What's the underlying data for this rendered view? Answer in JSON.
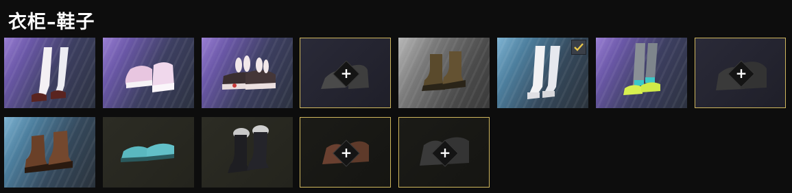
{
  "title": "衣柜–鞋子",
  "plus_symbol": "+",
  "items": [
    {
      "name": "white-stockings-maryjanes",
      "icon": "stockings-maryjane-icon",
      "background": "purple",
      "equipped": false,
      "empty": false
    },
    {
      "name": "pink-sneakers",
      "icon": "pink-sneakers-icon",
      "background": "purple",
      "equipped": false,
      "empty": false
    },
    {
      "name": "bunny-sneakers",
      "icon": "bunny-sneakers-icon",
      "background": "purple",
      "equipped": false,
      "empty": false
    },
    {
      "name": "empty-slot-black-shoes",
      "icon": "black-shoes-silhouette-icon",
      "background": "empty",
      "equipped": false,
      "empty": true
    },
    {
      "name": "brown-combat-boots",
      "icon": "combat-boots-icon",
      "background": "gray",
      "equipped": false,
      "empty": false
    },
    {
      "name": "white-stockings-shoes",
      "icon": "white-stockings-icon",
      "background": "blue",
      "equipped": true,
      "empty": false
    },
    {
      "name": "metal-leg-sneakers",
      "icon": "metal-leg-sneakers-icon",
      "background": "purple",
      "equipped": false,
      "empty": false
    },
    {
      "name": "empty-slot-dark-boots",
      "icon": "dark-boots-silhouette-icon",
      "background": "empty",
      "equipped": false,
      "empty": true
    },
    {
      "name": "brown-leather-boots",
      "icon": "leather-boots-icon",
      "background": "blue",
      "equipped": false,
      "empty": false
    },
    {
      "name": "teal-clogs",
      "icon": "teal-clogs-icon",
      "background": "olive",
      "equipped": false,
      "empty": false
    },
    {
      "name": "fur-tall-boots",
      "icon": "fur-boots-icon",
      "background": "olive",
      "equipped": false,
      "empty": false
    },
    {
      "name": "empty-slot-brown-boots",
      "icon": "brown-boots-silhouette-icon",
      "background": "empty-dark",
      "equipped": false,
      "empty": true
    },
    {
      "name": "empty-slot-gray-boots",
      "icon": "gray-boots-silhouette-icon",
      "background": "empty-dark",
      "equipped": false,
      "empty": true
    }
  ],
  "colors": {
    "frame_gold": "#d1b85e",
    "check_yellow": "#e9c64a",
    "background": "#0d0d0d"
  }
}
